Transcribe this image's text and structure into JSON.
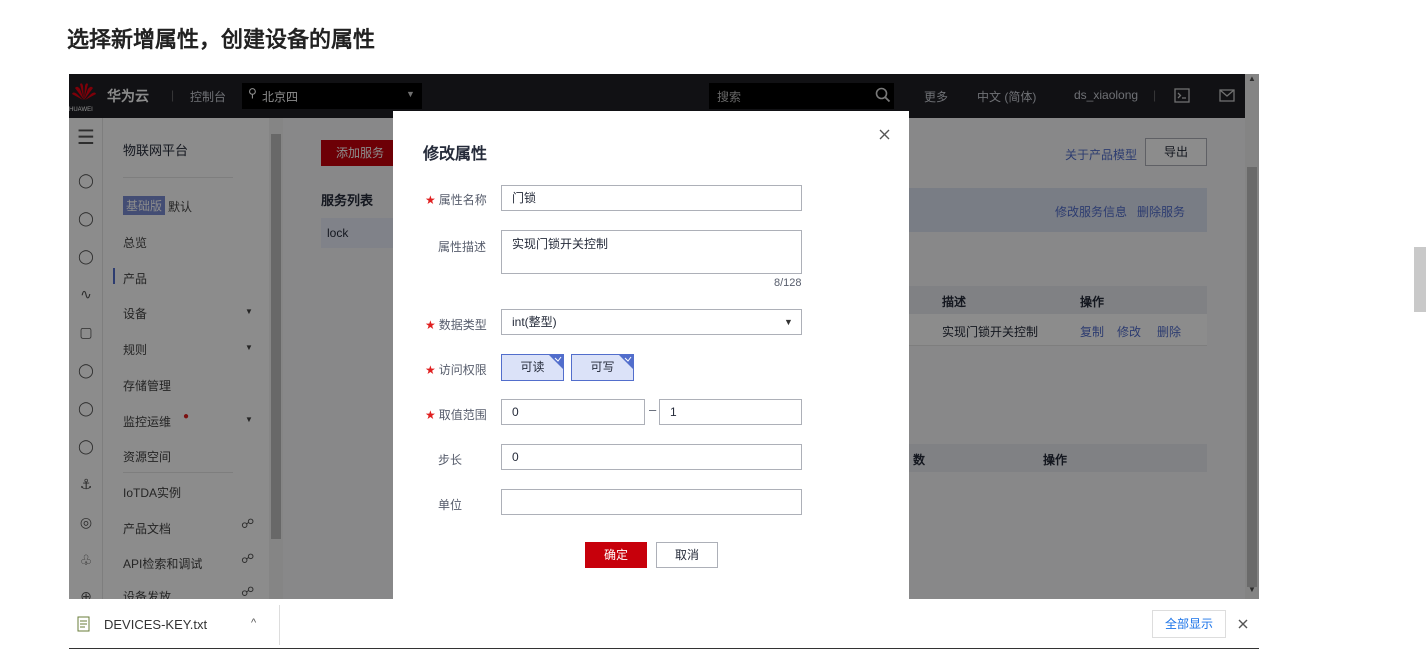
{
  "heading": "选择新增属性，创建设备的属性",
  "topbar": {
    "brand": "华为云",
    "logo_text": "HUAWEI",
    "console": "控制台",
    "region": "北京四",
    "search_placeholder": "搜索",
    "more": "更多",
    "language": "中文 (简体)",
    "user": "ds_xiaolong"
  },
  "sidebar": {
    "title": "物联网平台",
    "edition_badge": "基础版",
    "edition_name": "默认",
    "items": [
      "总览",
      "产品",
      "设备",
      "规则",
      "存储管理",
      "监控运维",
      "资源空间",
      "IoTDA实例",
      "产品文档",
      "API检索和调试",
      "设备发放"
    ]
  },
  "main": {
    "add_service": "添加服务",
    "service_list": "服务列表",
    "service_item": "lock",
    "about_model": "关于产品模型",
    "export": "导出",
    "edit_service_info": "修改服务信息",
    "delete_service": "删除服务",
    "col_desc": "描述",
    "col_ops": "操作",
    "row_desc": "实现门锁开关控制",
    "op_copy": "复制",
    "op_edit": "修改",
    "op_delete": "删除",
    "col_partial": "数",
    "col_ops2": "操作"
  },
  "modal": {
    "title": "修改属性",
    "name_label": "属性名称",
    "name_value": "门锁",
    "desc_label": "属性描述",
    "desc_value": "实现门锁开关控制",
    "desc_count": "8/128",
    "type_label": "数据类型",
    "type_value": "int(整型)",
    "access_label": "访问权限",
    "access_read": "可读",
    "access_write": "可写",
    "range_label": "取值范围",
    "range_min": "0",
    "range_sep": "–",
    "range_max": "1",
    "step_label": "步长",
    "step_value": "0",
    "unit_label": "单位",
    "unit_value": "",
    "ok": "确定",
    "cancel": "取消"
  },
  "download_bar": {
    "file": "DEVICES-KEY.txt",
    "show_all": "全部显示"
  },
  "colors": {
    "topbar": "#1f2026",
    "primary_red": "#c7000b",
    "link_blue": "#526ecc",
    "selected_bg": "#dbe2f8"
  }
}
